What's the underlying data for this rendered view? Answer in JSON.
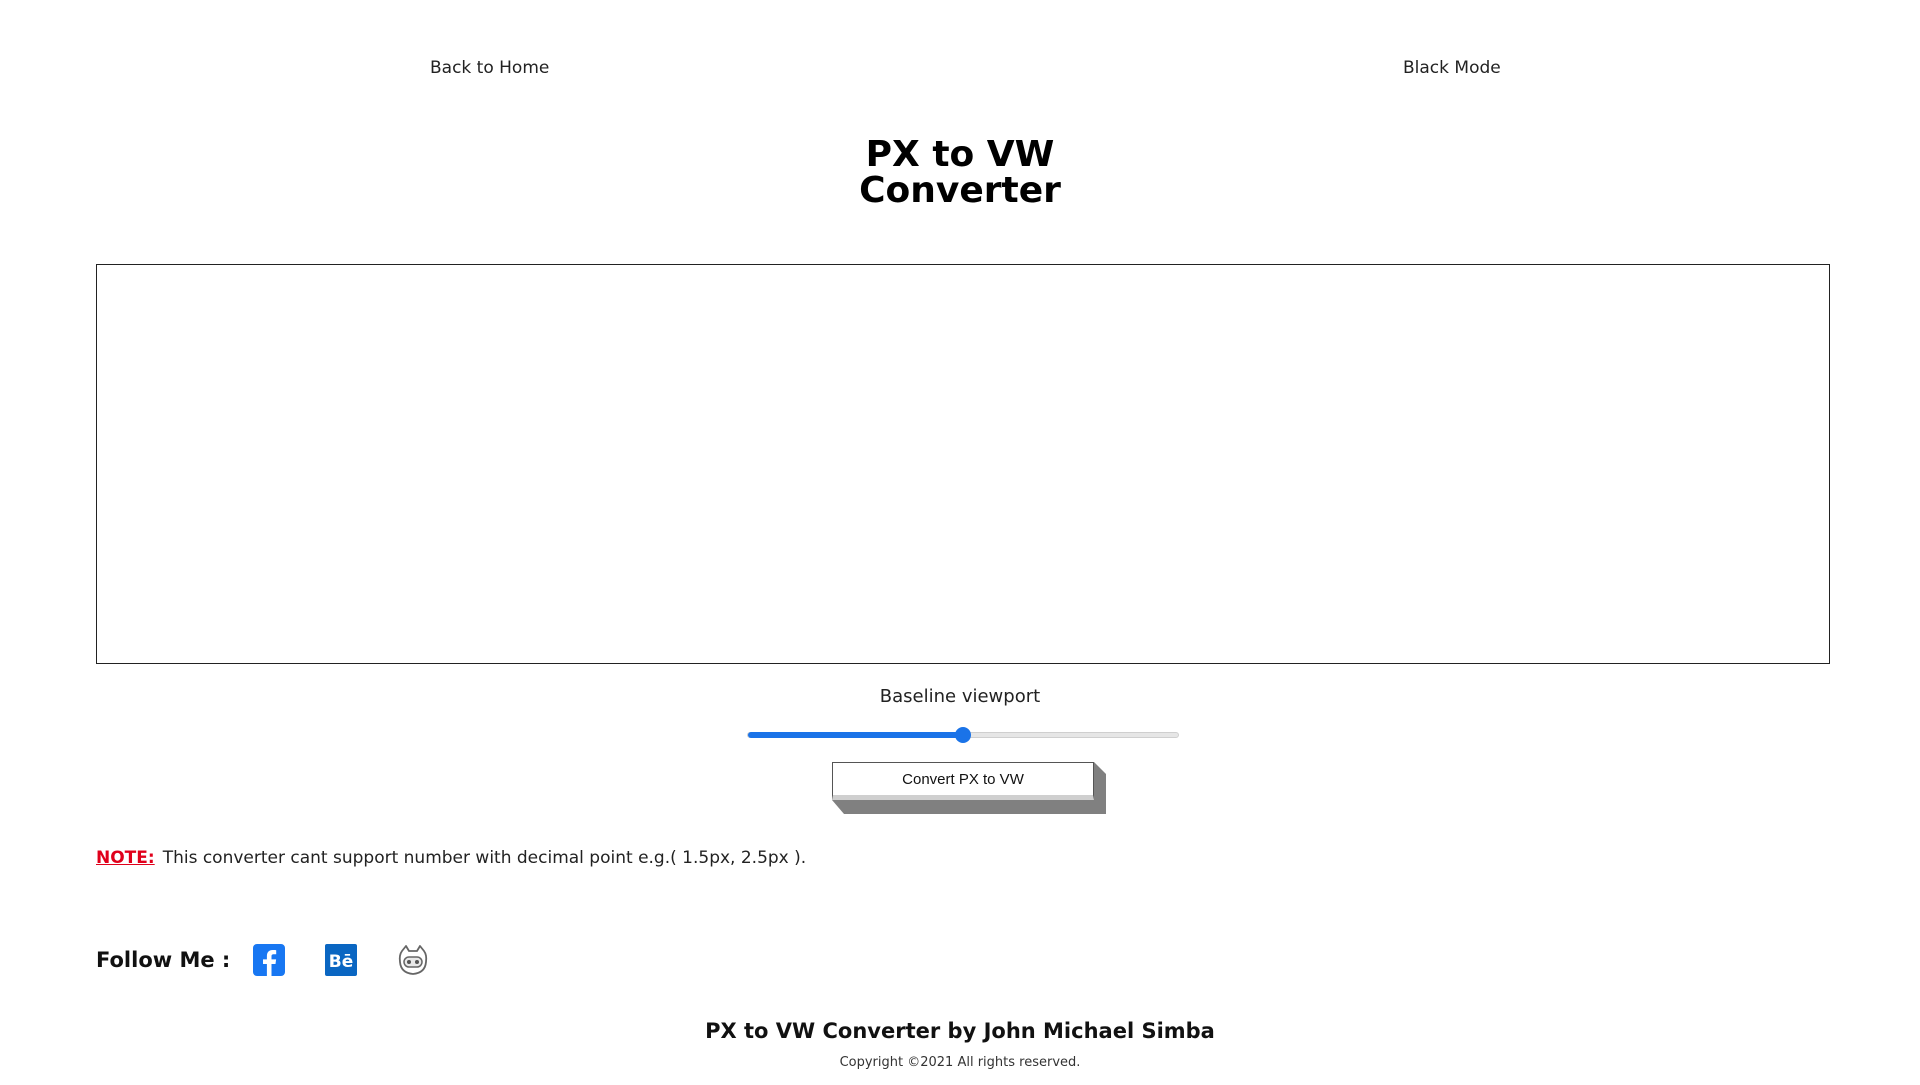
{
  "nav": {
    "back_home": "Back to Home",
    "mode_toggle": "Black Mode"
  },
  "header": {
    "title_line1": "PX to VW",
    "title_line2": "Converter"
  },
  "editor": {
    "value": "",
    "placeholder": ""
  },
  "viewport": {
    "label": "Baseline viewport",
    "slider_fraction": 0.5
  },
  "actions": {
    "convert_label": "Convert PX to VW"
  },
  "note": {
    "label": "NOTE:",
    "text": "This converter cant support number with decimal point e.g.( 1.5px, 2.5px )."
  },
  "social": {
    "label": "Follow Me :",
    "icons": [
      "facebook-icon",
      "behance-icon",
      "github-icon"
    ]
  },
  "footer": {
    "title": "PX to VW Converter by John Michael Simba",
    "copyright": "Copyright ©2021 All rights reserved."
  },
  "colors": {
    "accent": "#1a73e8",
    "note_red": "#e0001b",
    "facebook_blue": "#1877f2",
    "behance_blue": "#0a66c2"
  }
}
